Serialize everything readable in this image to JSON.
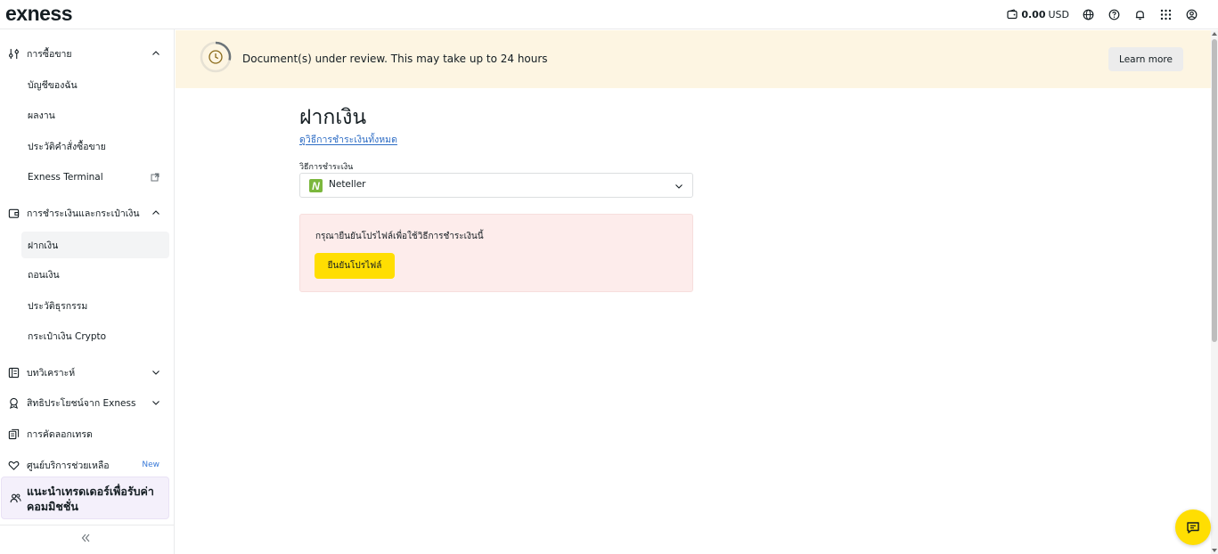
{
  "header": {
    "logo": "exness",
    "balance_amount": "0.00",
    "balance_currency": "USD",
    "icons": [
      "wallet-icon",
      "globe-icon",
      "help-icon",
      "bell-icon",
      "apps-grid-icon",
      "account-icon"
    ]
  },
  "sidebar": {
    "trading": {
      "label": "การซื้อขาย",
      "icon": "sliders-icon"
    },
    "trading_items": [
      "บัญชีของฉัน",
      "ผลงาน",
      "ประวัติคำสั่งซื้อขาย",
      "Exness Terminal"
    ],
    "payments": {
      "label": "การชำระเงินและกระเป๋าเงิน",
      "icon": "wallet-icon"
    },
    "payments_items": [
      "ฝากเงิน",
      "ถอนเงิน",
      "ประวัติธุรกรรม",
      "กระเป๋าเงิน Crypto"
    ],
    "analytics": {
      "label": "บทวิเคราะห์",
      "icon": "analytics-icon"
    },
    "benefits": {
      "label": "สิทธิประโยชน์จาก Exness",
      "icon": "award-icon"
    },
    "copy_trading": {
      "label": "การคัดลอกเทรด",
      "icon": "copy-icon"
    },
    "support": {
      "label": "ศูนย์บริการช่วยเหลือ",
      "badge": "New",
      "icon": "heart-icon"
    },
    "promo": {
      "label": "แนะนำเทรดเดอร์เพื่อรับค่าคอมมิชชั่น",
      "icon": "users-icon"
    }
  },
  "banner": {
    "text": "Document(s) under review. This may take up to 24 hours",
    "button": "Learn more"
  },
  "main": {
    "title": "ฝากเงิน",
    "all_methods_link": "ดูวิธีการชำระเงินทั้งหมด",
    "method_label": "วิธีการชำระเงิน",
    "method_logo_letter": "N",
    "method_value": "Neteller",
    "alert_text": "กรุณายืนยันโปรไฟล์เพื่อใช้วิธีการชำระเงินนี้",
    "verify_button": "ยืนยันโปรไฟล์"
  },
  "colors": {
    "accent_yellow": "#ffde02",
    "banner_bg": "#fdf5e2",
    "alert_bg": "#fdeceb",
    "link_blue": "#2d6cc4",
    "neteller_green": "#7bb73d",
    "promo_bg": "#f4f0fb"
  }
}
